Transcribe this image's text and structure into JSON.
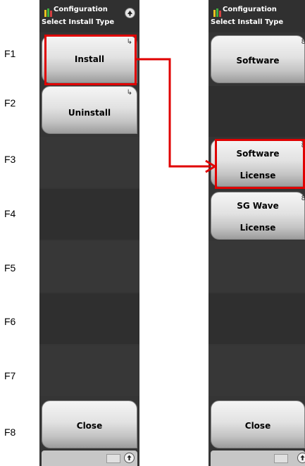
{
  "fkeys": [
    "F1",
    "F2",
    "F3",
    "F4",
    "F5",
    "F6",
    "F7",
    "F8"
  ],
  "left_panel": {
    "title": "Configuration",
    "subtitle": "Select Install Type",
    "buttons": {
      "f1": "Install",
      "f2": "Uninstall",
      "f8": "Close"
    }
  },
  "right_panel": {
    "title": "Configuration",
    "subtitle": "Select Install Type",
    "buttons": {
      "f1": "Software",
      "f3_line1": "Software",
      "f3_line2": "License",
      "f4_line1": "SG Wave",
      "f4_line2": "License",
      "f8": "Close"
    }
  },
  "icons": {
    "app": "configuration-icon",
    "scroll_up": "arrow-up-icon",
    "submenu": "submenu-arrow-icon",
    "return": "return-icon"
  },
  "colors": {
    "highlight": "#e00000",
    "panel": "#353535"
  }
}
